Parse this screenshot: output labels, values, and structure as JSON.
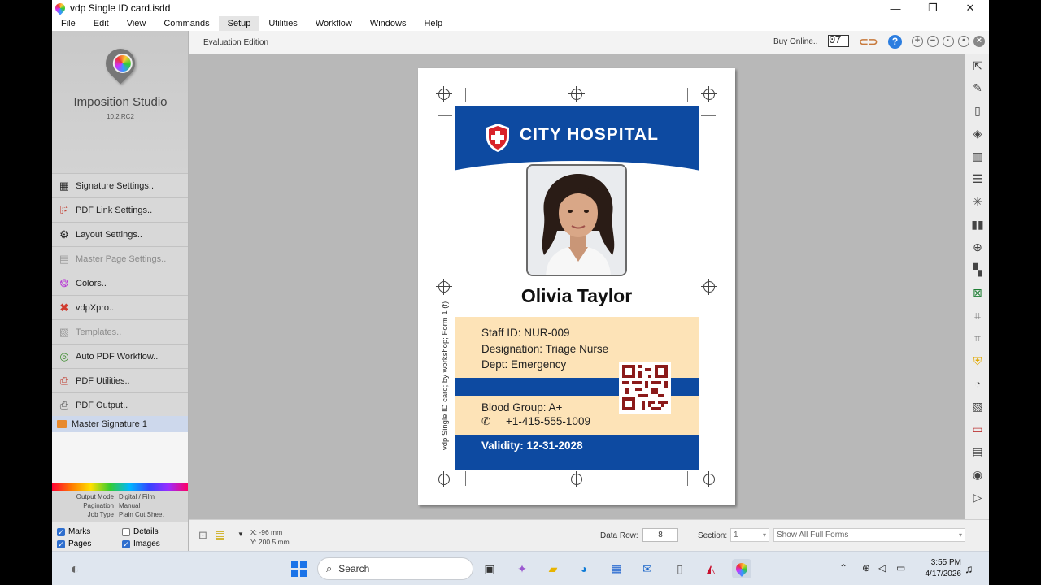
{
  "window": {
    "title": "vdp Single ID card.isdd",
    "minimize": "—",
    "maximize": "❐",
    "close": "✕"
  },
  "menu": [
    "File",
    "Edit",
    "View",
    "Commands",
    "Setup",
    "Utilities",
    "Workflow",
    "Windows",
    "Help"
  ],
  "sidebar": {
    "app_name": "Imposition Studio",
    "version": "10.2.RC2",
    "items": [
      {
        "label": "Signature Settings..",
        "icon": "signature-icon"
      },
      {
        "label": "PDF Link Settings..",
        "icon": "pdf-link-icon"
      },
      {
        "label": "Layout Settings..",
        "icon": "gear-icon"
      },
      {
        "label": "Master Page Settings..",
        "icon": "master-page-icon"
      },
      {
        "label": "Colors..",
        "icon": "colors-icon"
      },
      {
        "label": "vdpXpro..",
        "icon": "vdpxpro-icon"
      },
      {
        "label": "Templates..",
        "icon": "templates-icon"
      },
      {
        "label": "Auto PDF Workflow..",
        "icon": "workflow-icon"
      },
      {
        "label": "PDF Utilities..",
        "icon": "pdf-utilities-icon"
      },
      {
        "label": "PDF Output..",
        "icon": "printer-icon"
      }
    ],
    "master_signature": "Master Signature 1",
    "info": [
      {
        "key": "Output Mode",
        "value": "Digital / Film"
      },
      {
        "key": "Pagination",
        "value": "Manual"
      },
      {
        "key": "Job Type",
        "value": "Plain Cut Sheet"
      }
    ],
    "checks": {
      "marks": {
        "label": "Marks",
        "checked": true
      },
      "details": {
        "label": "Details",
        "checked": false
      },
      "pages": {
        "label": "Pages",
        "checked": true
      },
      "images": {
        "label": "Images",
        "checked": true
      }
    }
  },
  "toolbar": {
    "edition": "Evaluation Edition",
    "buy": "Buy Online..",
    "counter": "07"
  },
  "sheet": {
    "vertical_text": "vdp Single ID card; by workshop; Form 1 (f)"
  },
  "card": {
    "hospital": "CITY HOSPITAL",
    "name": "Olivia Taylor",
    "staff_id": "Staff ID: NUR-009",
    "designation": "Designation: Triage Nurse",
    "dept": "Dept: Emergency",
    "blood_group": "Blood Group: A+",
    "phone": "+1-415-555-1009",
    "validity": "Validity: 12-31-2028",
    "colors": {
      "primary": "#0d4aa1",
      "accent": "#fde3b7",
      "cross": "#d8232a"
    }
  },
  "status": {
    "x": "X: -96 mm",
    "y": "Y: 200.5 mm",
    "data_row_label": "Data Row:",
    "data_row_value": "8",
    "section_label": "Section:",
    "section_value": "1",
    "forms_value": "Show All Full Forms"
  },
  "taskbar": {
    "search": "Search",
    "time": "3:55 PM",
    "date": "4/17/2026"
  }
}
